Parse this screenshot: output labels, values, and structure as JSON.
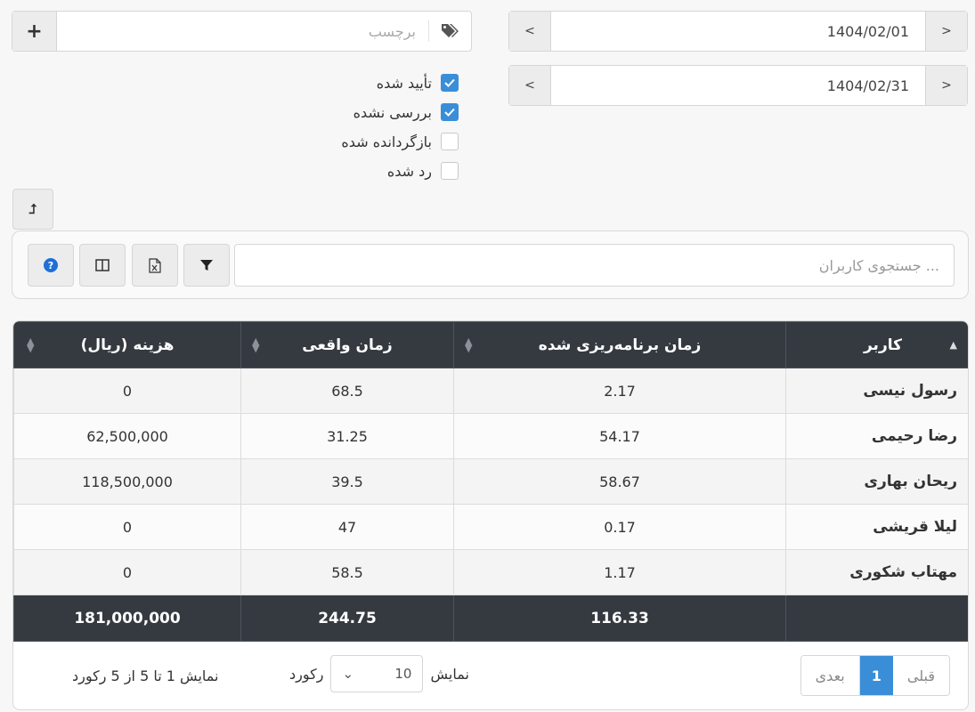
{
  "filters": {
    "date_from": "1404/02/01",
    "date_to": "1404/02/31",
    "prev_glyph": "<",
    "next_glyph": ">",
    "tag_placeholder": "برچسب",
    "add_glyph": "+",
    "statuses": [
      {
        "label": "تأیید شده",
        "checked": true
      },
      {
        "label": "بررسی نشده",
        "checked": true
      },
      {
        "label": "بازگردانده شده",
        "checked": false
      },
      {
        "label": "رد شده",
        "checked": false
      }
    ],
    "upload_glyph": "⮥"
  },
  "toolbar": {
    "search_placeholder": "جستجوی کاربران ...",
    "icons": [
      "help-icon",
      "columns-icon",
      "excel-icon",
      "filter-icon"
    ]
  },
  "table": {
    "headers": [
      "کاربر",
      "زمان برنامه‌ریزی شده",
      "زمان واقعی",
      "هزینه (ریال)"
    ],
    "rows": [
      {
        "user": "رسول نیسی",
        "planned": "2.17",
        "actual": "68.5",
        "cost": "0"
      },
      {
        "user": "رضا رحیمی",
        "planned": "54.17",
        "actual": "31.25",
        "cost": "62,500,000"
      },
      {
        "user": "ریحان بهاری",
        "planned": "58.67",
        "actual": "39.5",
        "cost": "118,500,000"
      },
      {
        "user": "لیلا قریشی",
        "planned": "0.17",
        "actual": "47",
        "cost": "0"
      },
      {
        "user": "مهتاب شکوری",
        "planned": "1.17",
        "actual": "58.5",
        "cost": "0"
      }
    ],
    "totals": {
      "user": "",
      "planned": "116.33",
      "actual": "244.75",
      "cost": "181,000,000"
    }
  },
  "pagination": {
    "prev": "قبلی",
    "current": "1",
    "next": "بعدی",
    "show_label": "نمایش",
    "page_size": "10",
    "records_label": "رکورد",
    "info": "نمایش 1 تا 5 از 5 رکورد"
  },
  "colors": {
    "accent": "#3a8ed8",
    "header_bg": "#343a40"
  }
}
